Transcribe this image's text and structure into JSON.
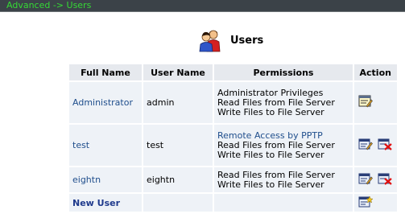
{
  "breadcrumb": "Advanced -> Users",
  "page_title": "Users",
  "table": {
    "headers": [
      "Full Name",
      "User Name",
      "Permissions",
      "Action"
    ],
    "rows": [
      {
        "full_name": "Administrator",
        "user_name": "admin",
        "permissions": [
          "Administrator Privileges",
          "Read Files from File Server",
          "Write Files to File Server"
        ],
        "actions": [
          "edit-icon"
        ]
      },
      {
        "full_name": "test",
        "user_name": "test",
        "permissions": [
          "Remote Access by PPTP",
          "Read Files from File Server",
          "Write Files to File Server"
        ],
        "actions": [
          "edit-icon",
          "delete-icon"
        ]
      },
      {
        "full_name": "eightn",
        "user_name": "eightn",
        "permissions": [
          "Read Files from File Server",
          "Write Files to File Server"
        ],
        "actions": [
          "edit-icon",
          "delete-icon"
        ]
      }
    ],
    "new_user_label": "New User"
  },
  "colors": {
    "breadcrumb_text": "#35d935",
    "link": "#1f4e8c",
    "header_bg": "#e6e9ee",
    "cell_bg": "#eef2f7"
  }
}
